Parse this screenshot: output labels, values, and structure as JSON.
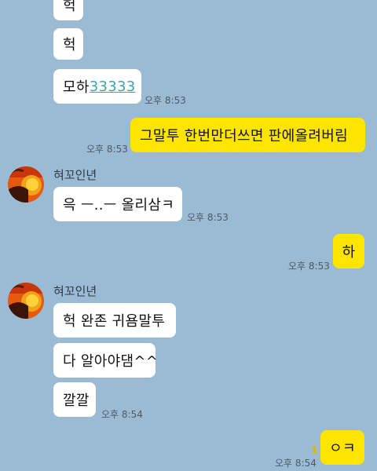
{
  "chat": {
    "messages": [
      {
        "text": "헉"
      },
      {
        "text": "헉"
      },
      {
        "prefix": "모하",
        "link": "33333",
        "time": "오후 8:53"
      },
      {
        "text": "그말투 한번만더쓰면 판에올려버림",
        "time": "오후 8:53"
      },
      {
        "sender": "혀꼬인년"
      },
      {
        "text": "윽 ㅡ..ㅡ 올리삼ㅋ",
        "time": "오후 8:53"
      },
      {
        "text": "하",
        "time": "오후 8:53"
      },
      {
        "sender": "혀꼬인년"
      },
      {
        "text": "헉 완존 귀욤말투"
      },
      {
        "text": "다 알아야댐^^"
      },
      {
        "text": "깔깔",
        "time": "오후 8:54"
      },
      {
        "text": "ㅇㅋ",
        "time": "오후 8:54",
        "unread": "1"
      }
    ]
  }
}
